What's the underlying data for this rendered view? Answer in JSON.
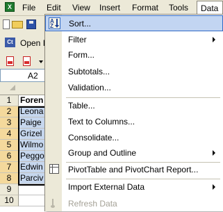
{
  "menubar": {
    "app_icon": "excel-icon",
    "menus": [
      "File",
      "Edit",
      "View",
      "Insert",
      "Format",
      "Tools",
      "Data"
    ],
    "active_menu": "Data"
  },
  "toolbar": {
    "row1_icons": [
      "new-document-icon",
      "open-folder-icon",
      "save-icon"
    ],
    "row2_badge": "Ct",
    "row2_label": "Open I",
    "row3_icons": [
      "pdf-icon",
      "pdf-dropdown-icon"
    ]
  },
  "namebox": {
    "value": "A2"
  },
  "grid": {
    "rows": [
      {
        "num": "1",
        "value": "Foren",
        "header": true
      },
      {
        "num": "2",
        "value": "Leona",
        "selected": true
      },
      {
        "num": "3",
        "value": "Paige",
        "selected": true
      },
      {
        "num": "4",
        "value": "Grizel",
        "selected": true
      },
      {
        "num": "5",
        "value": "Wilmo",
        "selected": true
      },
      {
        "num": "6",
        "value": "Peggo",
        "selected": true
      },
      {
        "num": "7",
        "value": "Edwin",
        "selected": true
      },
      {
        "num": "8",
        "value": "Parciv",
        "selected": true
      },
      {
        "num": "9",
        "value": ""
      },
      {
        "num": "10",
        "value": ""
      }
    ]
  },
  "data_menu": {
    "items": [
      {
        "label": "Sort...",
        "icon": "sort-ascending-icon",
        "highlighted": true
      },
      {
        "label": "Filter",
        "submenu": true
      },
      {
        "label": "Form..."
      },
      {
        "label": "Subtotals..."
      },
      {
        "label": "Validation..."
      },
      {
        "label": "Table..."
      },
      {
        "label": "Text to Columns..."
      },
      {
        "label": "Consolidate..."
      },
      {
        "label": "Group and Outline",
        "submenu": true
      },
      {
        "label": "PivotTable and PivotChart Report...",
        "icon": "pivot-table-icon"
      },
      {
        "label": "Import External Data",
        "submenu": true
      },
      {
        "label": "Refresh Data",
        "icon": "refresh-icon",
        "disabled": true
      }
    ]
  },
  "colors": {
    "chrome": "#ece9d8",
    "highlight": "#c2d5f2",
    "highlight_border": "#316ac5",
    "selection_fill": "#c6d7ee",
    "disabled_text": "#a4a196"
  }
}
